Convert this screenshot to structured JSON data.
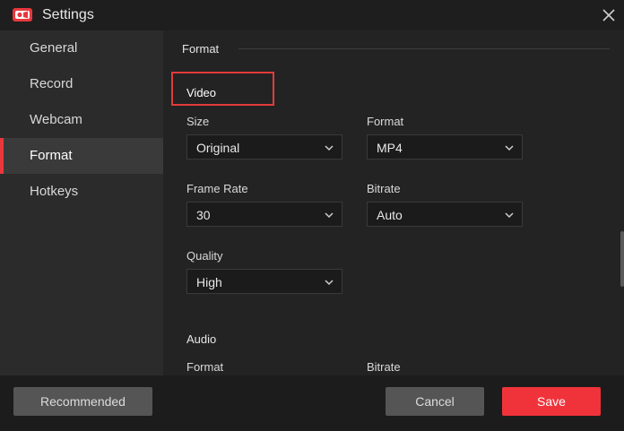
{
  "window": {
    "title": "Settings",
    "app_icon": "recorder-camera-icon",
    "close_icon": "close-icon"
  },
  "sidebar": {
    "items": [
      {
        "label": "General",
        "active": false
      },
      {
        "label": "Record",
        "active": false
      },
      {
        "label": "Webcam",
        "active": false
      },
      {
        "label": "Format",
        "active": true
      },
      {
        "label": "Hotkeys",
        "active": false
      }
    ]
  },
  "main": {
    "section_title": "Format",
    "video": {
      "heading": "Video",
      "size": {
        "label": "Size",
        "value": "Original"
      },
      "format": {
        "label": "Format",
        "value": "MP4"
      },
      "frame_rate": {
        "label": "Frame Rate",
        "value": "30"
      },
      "bitrate": {
        "label": "Bitrate",
        "value": "Auto"
      },
      "quality": {
        "label": "Quality",
        "value": "High"
      }
    },
    "audio": {
      "heading": "Audio",
      "format": {
        "label": "Format"
      },
      "bitrate": {
        "label": "Bitrate"
      }
    }
  },
  "footer": {
    "recommended_label": "Recommended",
    "cancel_label": "Cancel",
    "save_label": "Save"
  },
  "colors": {
    "accent": "#f0333a",
    "highlight_box": "#e23b3b"
  }
}
